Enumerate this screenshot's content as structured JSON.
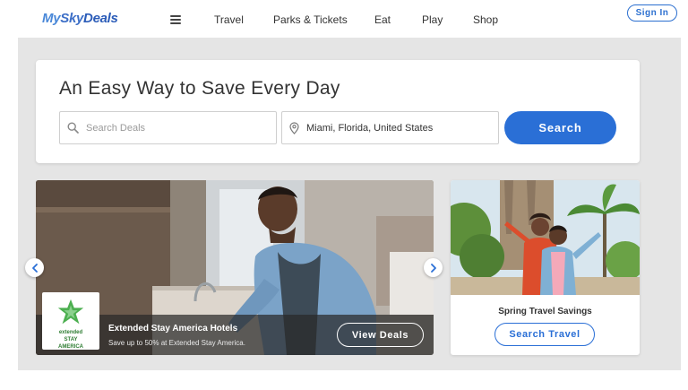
{
  "header": {
    "logo": {
      "part1": "My",
      "part2": "Sky",
      "part3": "Deals"
    },
    "nav": [
      "Travel",
      "Parks & Tickets",
      "Eat",
      "Play",
      "Shop"
    ],
    "sign_in": "Sign In"
  },
  "search": {
    "title": "An Easy Way to Save Every Day",
    "deals_placeholder": "Search Deals",
    "location_value": "Miami, Florida, United States",
    "button": "Search"
  },
  "hero": {
    "logo_caption_1": "extended",
    "logo_caption_2": "STAY",
    "logo_caption_3": "AMERICA",
    "title": "Extended Stay America Hotels",
    "subtitle": "Save up to 50% at Extended Stay America.",
    "button": "View Deals"
  },
  "side": {
    "title": "Spring Travel Savings",
    "button": "Search Travel"
  },
  "colors": {
    "brand_blue": "#2a6fd6",
    "page_grey": "#e5e5e5",
    "logo_green": "#4caf50"
  },
  "icons": [
    "menu-icon",
    "search-icon",
    "location-pin-icon",
    "chevron-left-icon",
    "chevron-right-icon"
  ]
}
